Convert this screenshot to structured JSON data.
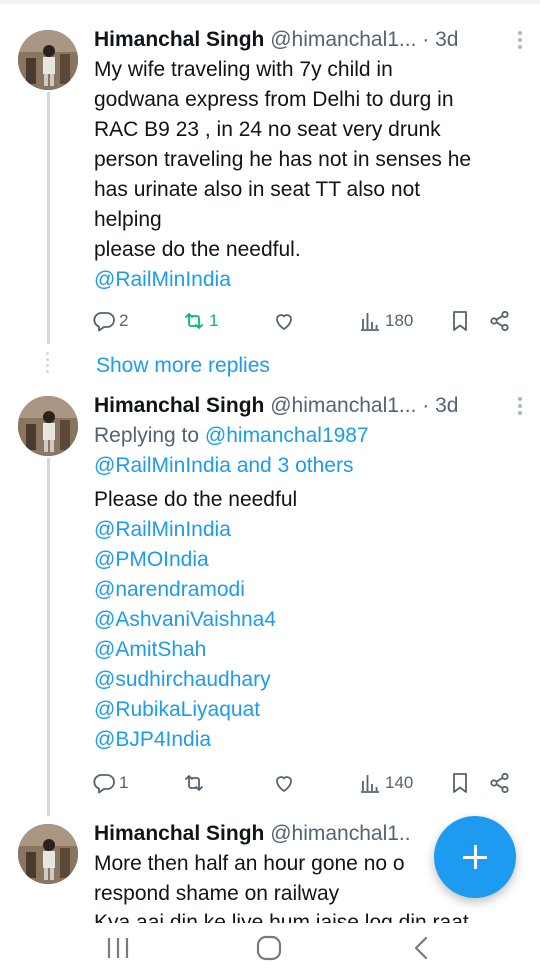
{
  "tweets": [
    {
      "name": "Himanchal Singh",
      "handle": "@himanchal1...",
      "time": "· 3d",
      "lines": [
        "My wife traveling with 7y child in",
        "godwana express from Delhi to durg in",
        "RAC B9 23 , in 24 no seat very drunk",
        "person traveling he has not in senses he",
        "has urinate also in seat TT also not",
        "helping",
        "please do the needful."
      ],
      "mentions": [
        "@RailMinIndia"
      ],
      "replies": "2",
      "retweets": "1",
      "views": "180"
    },
    {
      "name": "Himanchal Singh",
      "handle": "@himanchal1...",
      "time": "· 3d",
      "replying_to": "Replying to",
      "replying_handle": "@himanchal1987",
      "replying_others": "@RailMinIndia and 3 others",
      "text": "Please do the needful",
      "mentions": [
        "@RailMinIndia",
        "@PMOIndia",
        "@narendramodi",
        "@AshvaniVaishna4",
        "@AmitShah",
        "@sudhirchaudhary",
        "@RubikaLiyaquat",
        "@BJP4India"
      ],
      "replies": "1",
      "views": "140"
    },
    {
      "name": "Himanchal Singh",
      "handle": "@himanchal1..",
      "lines": [
        "More then half an hour gone no o",
        "respond shame on railway",
        "Kya aai din ke liye hum jaise log din raat"
      ]
    }
  ],
  "show_more": "Show more replies",
  "colors": {
    "accent": "#1d9bf0",
    "retweet_active": "#00ba7c",
    "muted": "#536471"
  }
}
